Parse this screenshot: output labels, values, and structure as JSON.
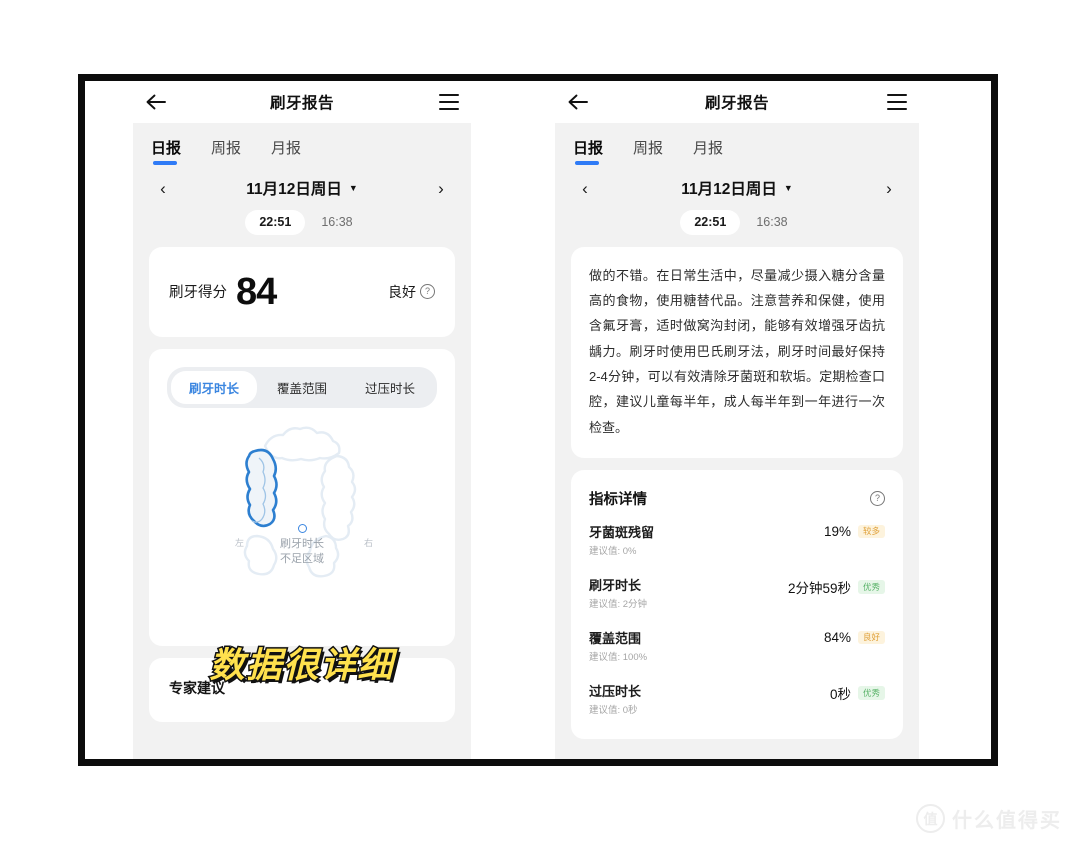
{
  "app": {
    "nav": {
      "back_icon": "arrow-left-icon",
      "title": "刷牙报告",
      "menu_icon": "hamburger-menu-icon"
    },
    "tabs": [
      {
        "label": "日报",
        "active": true
      },
      {
        "label": "周报",
        "active": false
      },
      {
        "label": "月报",
        "active": false
      }
    ],
    "date_nav": {
      "prev": "‹",
      "label": "11月12日周日",
      "caret": "▼",
      "next": "›"
    },
    "sessions": [
      {
        "time": "22:51",
        "selected": true
      },
      {
        "time": "16:38",
        "selected": false
      }
    ]
  },
  "left_panel": {
    "score_card": {
      "label": "刷牙得分",
      "value": "84",
      "rating": "良好",
      "help_icon": "question-circle-icon"
    },
    "segmented": [
      {
        "label": "刷牙时长",
        "active": true
      },
      {
        "label": "覆盖范围",
        "active": false
      },
      {
        "label": "过压时长",
        "active": false
      }
    ],
    "diagram": {
      "left_label": "左",
      "right_label": "右",
      "legend_line1": "刷牙时长",
      "legend_line2": "不足区域",
      "highlight_color": "#2d7fd0",
      "inactive_color": "#e4ecf4"
    },
    "overlay_caption": "数据很详细",
    "expert_card": {
      "title": "专家建议"
    }
  },
  "right_panel": {
    "advice_text": "做的不错。在日常生活中，尽量减少摄入糖分含量高的食物，使用糖替代品。注意营养和保健，使用含氟牙膏，适时做窝沟封闭，能够有效增强牙齿抗龋力。刷牙时使用巴氏刷牙法，刷牙时间最好保持2-4分钟，可以有效清除牙菌斑和软垢。定期检查口腔，建议儿童每半年，成人每半年到一年进行一次检查。",
    "detail_card": {
      "title": "指标详情",
      "help_icon": "question-circle-icon",
      "metrics": [
        {
          "name": "牙菌斑残留",
          "recommended": "建议值: 0%",
          "value": "19%",
          "badge": "较多",
          "badge_type": "warn"
        },
        {
          "name": "刷牙时长",
          "recommended": "建议值: 2分钟",
          "value": "2分钟59秒",
          "badge": "优秀",
          "badge_type": "good"
        },
        {
          "name": "覆盖范围",
          "recommended": "建议值: 100%",
          "value": "84%",
          "badge": "良好",
          "badge_type": "warn"
        },
        {
          "name": "过压时长",
          "recommended": "建议值: 0秒",
          "value": "0秒",
          "badge": "优秀",
          "badge_type": "good"
        }
      ]
    }
  },
  "watermark": {
    "logo": "值",
    "text": "什么值得买"
  }
}
